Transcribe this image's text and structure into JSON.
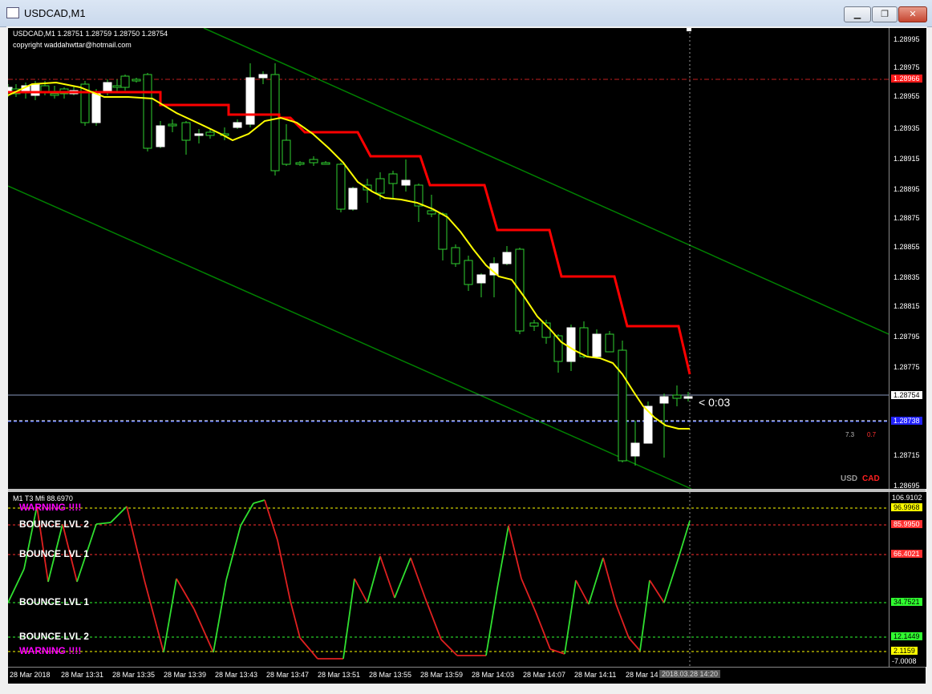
{
  "window": {
    "title": "USDCAD,M1",
    "minimize": "▁",
    "maximize": "❐",
    "close": "✕"
  },
  "chart": {
    "header": "USDCAD,M1  1.28751 1.28759 1.28750 1.28754",
    "copyright": "copyright waddahwttar@hotmail.com",
    "countdown": "< 0:03",
    "stat_a": "7.3",
    "stat_b": "0.7",
    "symbol_base": "USD",
    "symbol_quote": "CAD",
    "price_ticks": [
      "1.28995",
      "1.28975",
      "1.28955",
      "1.28935",
      "1.28915",
      "1.28895",
      "1.28875",
      "1.28855",
      "1.28835",
      "1.28815",
      "1.28795",
      "1.28775",
      "1.28715",
      "1.28695"
    ],
    "current_price": "1.28754",
    "resistance_price": "1.28966",
    "support_price": "1.28738"
  },
  "indicator": {
    "header": "M1  T3 Mfi  88.6970",
    "levels": [
      {
        "label": "WARNING  !!!!",
        "value": "96.9968",
        "color": "#ffff00",
        "label_color": "#ff00ff"
      },
      {
        "label": "BOUNCE LVL 2",
        "value": "85.9950",
        "color": "#ff3030",
        "label_color": "#ffffff"
      },
      {
        "label": "BOUNCE LVL 1",
        "value": "66.4021",
        "color": "#ff3030",
        "label_color": "#ffffff"
      },
      {
        "label": "BOUNCE LVL 1",
        "value": "34.7521",
        "color": "#30ff30",
        "label_color": "#ffffff"
      },
      {
        "label": "BOUNCE LVL 2",
        "value": "12.1449",
        "color": "#30ff30",
        "label_color": "#ffffff"
      },
      {
        "label": "WARNING  !!!!",
        "value": "2.1159",
        "color": "#ffff00",
        "label_color": "#ff00ff"
      }
    ],
    "scale_top": "106.9102",
    "scale_bottom": "-7.0008"
  },
  "time_axis": {
    "labels": [
      "28 Mar 2018",
      "28 Mar 13:31",
      "28 Mar 13:35",
      "28 Mar 13:39",
      "28 Mar 13:43",
      "28 Mar 13:47",
      "28 Mar 13:51",
      "28 Mar 13:55",
      "28 Mar 13:59",
      "28 Mar 14:03",
      "28 Mar 14:07",
      "28 Mar 14:11",
      "28 Mar 14"
    ],
    "cursor_label": "2018.03.28 14:20"
  },
  "colors": {
    "bull": "#ffffff",
    "wick": "#30d030",
    "sar": "#ff0000",
    "ma": "#ffff00",
    "channel": "#008000"
  }
}
